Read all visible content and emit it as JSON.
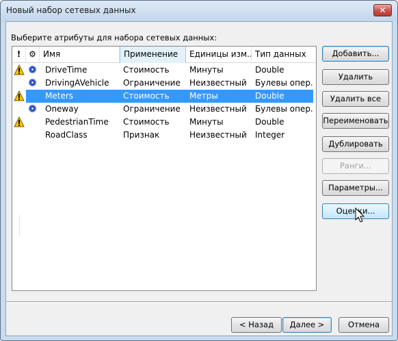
{
  "window": {
    "title": "Новый набор сетевых данных",
    "close_glyph": "✕"
  },
  "prompt": "Выберите атрибуты для набора сетевых данных:",
  "table": {
    "headers": {
      "warn": "!",
      "gear": "⚙",
      "name": "Имя",
      "usage": "Применение",
      "units": "Единицы изм...",
      "type": "Тип данных"
    },
    "rows": [
      {
        "warning": true,
        "gear": true,
        "name": "DriveTime",
        "usage": "Стоимость",
        "units": "Минуты",
        "type": "Double",
        "selected": false
      },
      {
        "warning": false,
        "gear": true,
        "name": "DrivingAVehicle",
        "usage": "Ограничение",
        "units": "Неизвестный",
        "type": "Булевы опер...",
        "selected": false
      },
      {
        "warning": true,
        "gear": false,
        "name": "Meters",
        "usage": "Стоимость",
        "units": "Метры",
        "type": "Double",
        "selected": true
      },
      {
        "warning": false,
        "gear": true,
        "name": "Oneway",
        "usage": "Ограничение",
        "units": "Неизвестный",
        "type": "Булевы опер...",
        "selected": false
      },
      {
        "warning": true,
        "gear": false,
        "name": "PedestrianTime",
        "usage": "Стоимость",
        "units": "Минуты",
        "type": "Double",
        "selected": false
      },
      {
        "warning": false,
        "gear": false,
        "name": "RoadClass",
        "usage": "Признак",
        "units": "Неизвестный",
        "type": "Integer",
        "selected": false
      }
    ]
  },
  "buttons": {
    "add": "Добавить...",
    "remove": "Удалить",
    "remove_all": "Удалить все",
    "rename": "Переименовать",
    "duplicate": "Дублировать",
    "ranges": "Ранги...",
    "parameters": "Параметры...",
    "evaluators": "Оценки...",
    "back": "< Назад",
    "next": "Далее >",
    "cancel": "Отмена"
  },
  "icons": {
    "warning": "warning-icon",
    "gear": "gear-icon",
    "cursor": "mouse-pointer-icon"
  },
  "colors": {
    "selection": "#3399ff",
    "header_selected": "#e3f1fb"
  }
}
